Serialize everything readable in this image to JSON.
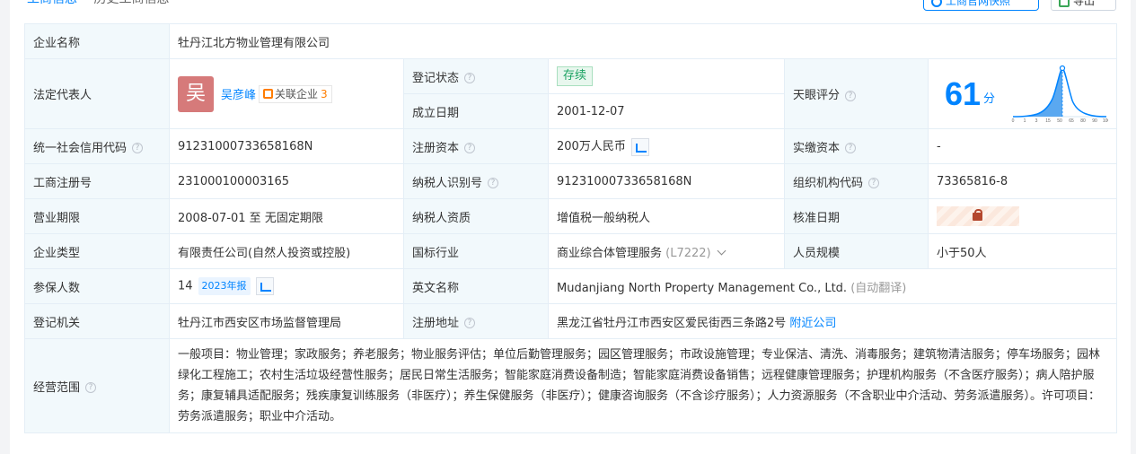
{
  "tabs": [
    "工商信息",
    "历史工商信息"
  ],
  "top_buttons": {
    "gsxt_label": "工商官网快照",
    "export_label": "导出"
  },
  "company_name_label": "企业名称",
  "company_name": "牡丹江北方物业管理有限公司",
  "legal_rep": {
    "label": "法定代表人",
    "avatar_char": "吴",
    "name": "吴彦峰",
    "related_label": "关联企业",
    "related_count": "3"
  },
  "reg_status": {
    "label": "登记状态",
    "value": "存续"
  },
  "established": {
    "label": "成立日期",
    "value": "2001-12-07"
  },
  "rating": {
    "label": "天眼评分",
    "score": "61",
    "unit": "分",
    "ticks": [
      "0",
      "1",
      "3",
      "15",
      "50",
      "65",
      "80",
      "90",
      "100"
    ]
  },
  "credit_code": {
    "label": "统一社会信用代码",
    "value": "91231000733658168N"
  },
  "reg_capital": {
    "label": "注册资本",
    "value": "200万人民币"
  },
  "paid_capital": {
    "label": "实缴资本",
    "value": "-"
  },
  "biz_reg_no": {
    "label": "工商注册号",
    "value": "231000100003165"
  },
  "taxpayer_id": {
    "label": "纳税人识别号",
    "value": "91231000733658168N"
  },
  "org_code": {
    "label": "组织机构代码",
    "value": "73365816-8"
  },
  "biz_term": {
    "label": "营业期限",
    "value": "2008-07-01 至 无固定期限"
  },
  "taxpayer_quali": {
    "label": "纳税人资质",
    "value": "增值税一般纳税人"
  },
  "approval_date": {
    "label": "核准日期"
  },
  "company_type": {
    "label": "企业类型",
    "value": "有限责任公司(自然人投资或控股)"
  },
  "industry": {
    "label": "国标行业",
    "value": "商业综合体管理服务",
    "code": "(L7222)"
  },
  "staff_size": {
    "label": "人员规模",
    "value": "小于50人"
  },
  "insured": {
    "label": "参保人数",
    "value": "14",
    "report": "2023年报"
  },
  "english_name": {
    "label": "英文名称",
    "value": "Mudanjiang North Property Management Co., Ltd.",
    "note": "(自动翻译)"
  },
  "authority": {
    "label": "登记机关",
    "value": "牡丹江市西安区市场监督管理局"
  },
  "address": {
    "label": "注册地址",
    "value": "黑龙江省牡丹江市西安区爱民街西三条路2号",
    "nearby": "附近公司"
  },
  "scope": {
    "label": "经营范围",
    "value": "一般项目：物业管理；家政服务；养老服务；物业服务评估；单位后勤管理服务；园区管理服务；市政设施管理；专业保洁、清洗、消毒服务；建筑物清洁服务；停车场服务；园林绿化工程施工；农村生活垃圾经营性服务；居民日常生活服务；智能家庭消费设备制造；智能家庭消费设备销售；远程健康管理服务；护理机构服务（不含医疗服务）；病人陪护服务；康复辅具适配服务；残疾康复训练服务（非医疗）；养生保健服务（非医疗）；健康咨询服务（不含诊疗服务）；人力资源服务（不含职业中介活动、劳务派遣服务）。许可项目：劳务派遣服务；职业中介活动。"
  },
  "colors": {
    "accent": "#0084ff",
    "label_bg": "#f2f9fc",
    "status_green": "#1aa261"
  }
}
